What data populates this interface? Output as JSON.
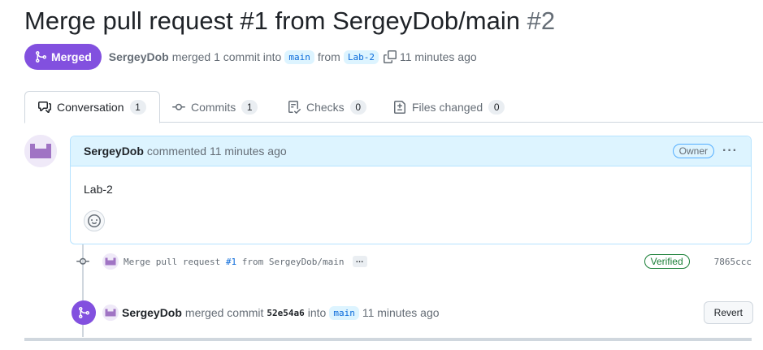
{
  "pr": {
    "title": "Merge pull request #1 from SergeyDob/main",
    "number": "#2",
    "state": "Merged",
    "author": "SergeyDob",
    "merged_text": "merged 1 commit into",
    "base_branch": "main",
    "from_text": "from",
    "head_branch": "Lab-2",
    "time": "11 minutes ago"
  },
  "tabs": [
    {
      "label": "Conversation",
      "count": "1",
      "icon": "comment-discussion-icon",
      "active": true
    },
    {
      "label": "Commits",
      "count": "1",
      "icon": "git-commit-icon"
    },
    {
      "label": "Checks",
      "count": "0",
      "icon": "checklist-icon"
    },
    {
      "label": "Files changed",
      "count": "0",
      "icon": "file-diff-icon"
    }
  ],
  "comment": {
    "author": "SergeyDob",
    "action": "commented 11 minutes ago",
    "role_badge": "Owner",
    "menu": "···",
    "body": "Lab-2"
  },
  "commit": {
    "message_prefix": "Merge pull request ",
    "message_link": "#1",
    "message_suffix": " from SergeyDob/main",
    "ellipsis": "…",
    "verified": "Verified",
    "sha": "7865ccc"
  },
  "merge_event": {
    "author": "SergeyDob",
    "action": "merged commit",
    "sha": "52e54a6",
    "into_text": "into",
    "branch": "main",
    "time": "11 minutes ago",
    "revert_label": "Revert"
  },
  "colors": {
    "merged_purple": "#8250df",
    "link_blue": "#0969da",
    "comment_header_bg": "#ddf4ff",
    "verified_green": "#1a7f37"
  }
}
